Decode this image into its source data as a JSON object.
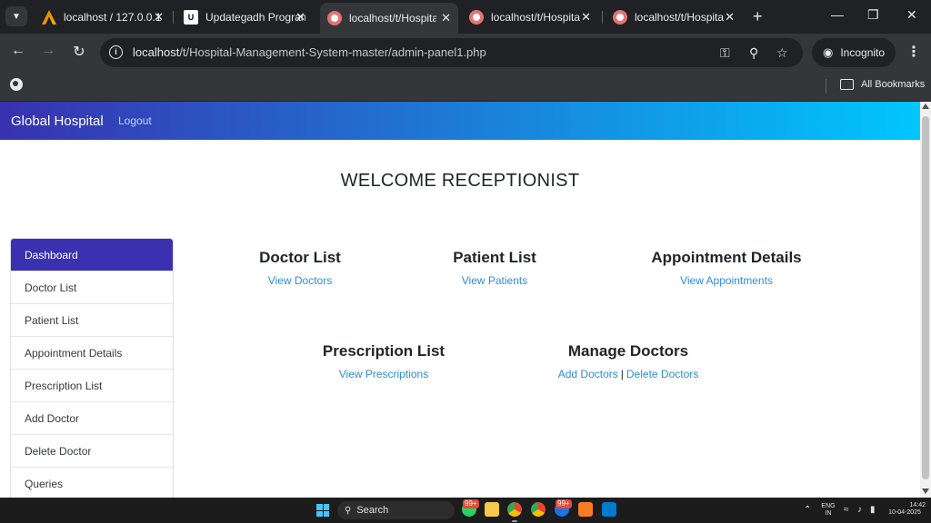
{
  "browser": {
    "tabs": [
      {
        "title": "localhost / 127.0.0.1",
        "favicon": "bird-icon",
        "active": false
      },
      {
        "title": "Updategadh Program",
        "favicon": "uc-icon",
        "active": false
      },
      {
        "title": "localhost/t/Hospital-M",
        "favicon": "hospital-icon",
        "active": true
      },
      {
        "title": "localhost/t/Hospital-M",
        "favicon": "hospital-icon",
        "active": false
      },
      {
        "title": "localhost/t/Hospital-M",
        "favicon": "hospital-icon",
        "active": false
      }
    ],
    "url_host": "localhost",
    "url_path": "/t/Hospital-Management-System-master/admin-panel1.php",
    "incognito_label": "Incognito",
    "bookmarks_label": "All Bookmarks"
  },
  "site": {
    "brand": "Global Hospital",
    "logout": "Logout",
    "welcome": "WELCOME RECEPTIONIST",
    "sidebar": [
      {
        "label": "Dashboard"
      },
      {
        "label": "Doctor List"
      },
      {
        "label": "Patient List"
      },
      {
        "label": "Appointment Details"
      },
      {
        "label": "Prescription List"
      },
      {
        "label": "Add Doctor"
      },
      {
        "label": "Delete Doctor"
      },
      {
        "label": "Queries"
      }
    ],
    "cards": {
      "doctor": {
        "title": "Doctor List",
        "link": "View Doctors"
      },
      "patient": {
        "title": "Patient List",
        "link": "View Patients"
      },
      "appointment": {
        "title": "Appointment Details",
        "link": "View Appointments"
      },
      "prescription": {
        "title": "Prescription List",
        "link": "View Prescriptions"
      },
      "manage": {
        "title": "Manage Doctors",
        "link_add": "Add Doctors",
        "separator": "|",
        "link_delete": "Delete Doctors"
      }
    },
    "colors": {
      "nav_start": "#3931af",
      "nav_end": "#00c6ff",
      "link": "#2e8ddb",
      "active": "#3931af"
    }
  },
  "taskbar": {
    "search_label": "Search",
    "badge_1": "99+",
    "badge_2": "99+",
    "lang_1": "ENG",
    "lang_2": "IN",
    "time": "14:42",
    "date": "10-04-2025"
  }
}
